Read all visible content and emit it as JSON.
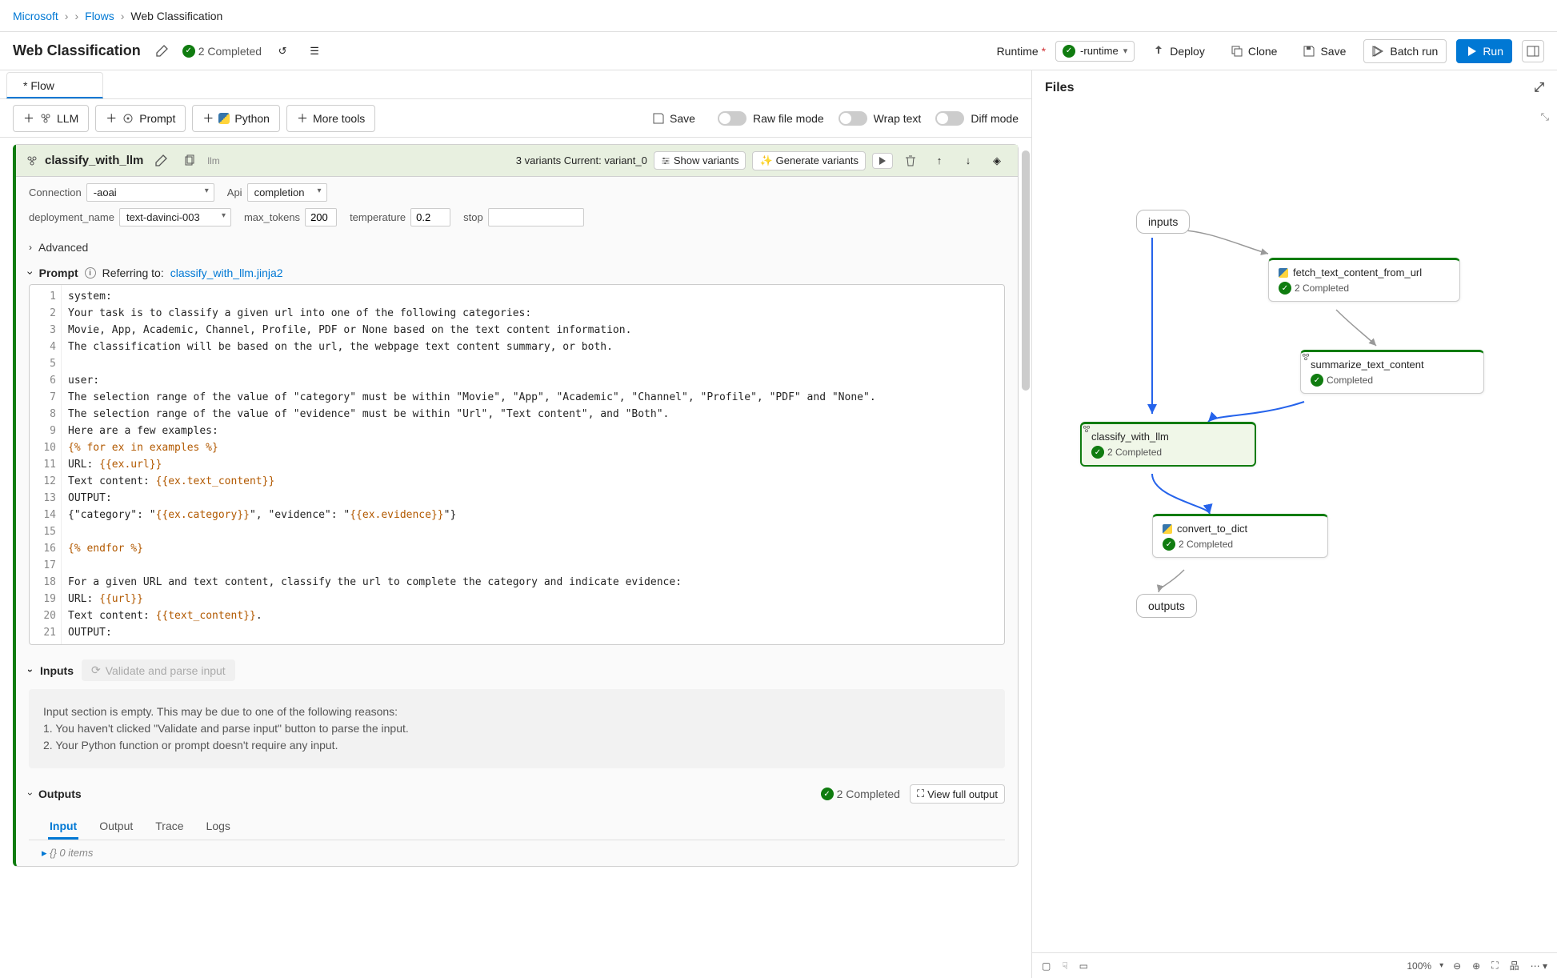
{
  "breadcrumb": {
    "root": "Microsoft",
    "flows": "Flows",
    "current": "Web Classification"
  },
  "header": {
    "title": "Web Classification",
    "status": "2 Completed",
    "runtime_label": "Runtime",
    "runtime_name": "-runtime",
    "deploy": "Deploy",
    "clone": "Clone",
    "save": "Save",
    "batch": "Batch run",
    "run": "Run"
  },
  "tab": {
    "flow": "* Flow"
  },
  "toolbar": {
    "llm": "LLM",
    "prompt": "Prompt",
    "python": "Python",
    "more": "More tools",
    "save": "Save",
    "raw": "Raw file mode",
    "wrap": "Wrap text",
    "diff": "Diff mode"
  },
  "node": {
    "name": "classify_with_llm",
    "type": "llm",
    "variants_text": "3 variants  Current: variant_0",
    "show_variants": "Show variants",
    "generate": "Generate variants",
    "connection_label": "Connection",
    "connection_value": "-aoai",
    "api_label": "Api",
    "api_value": "completion",
    "deployment_label": "deployment_name",
    "deployment_value": "text-davinci-003",
    "maxtok_label": "max_tokens",
    "maxtok_value": "200",
    "temp_label": "temperature",
    "temp_value": "0.2",
    "stop_label": "stop",
    "stop_value": "",
    "advanced": "Advanced",
    "prompt_label": "Prompt",
    "referring": "Referring to:",
    "referring_file": "classify_with_llm.jinja2"
  },
  "code_lines": [
    "system:",
    "Your task is to classify a given url into one of the following categories:",
    "Movie, App, Academic, Channel, Profile, PDF or None based on the text content information.",
    "The classification will be based on the url, the webpage text content summary, or both.",
    "",
    "user:",
    "The selection range of the value of \"category\" must be within \"Movie\", \"App\", \"Academic\", \"Channel\", \"Profile\", \"PDF\" and \"None\".",
    "The selection range of the value of \"evidence\" must be within \"Url\", \"Text content\", and \"Both\".",
    "Here are a few examples:",
    "{% for ex in examples %}",
    "URL: {{ex.url}}",
    "Text content: {{ex.text_content}}",
    "OUTPUT:",
    "{\"category\": \"{{ex.category}}\", \"evidence\": \"{{ex.evidence}}\"}",
    "",
    "{% endfor %}",
    "",
    "For a given URL and text content, classify the url to complete the category and indicate evidence:",
    "URL: {{url}}",
    "Text content: {{text_content}}.",
    "OUTPUT:"
  ],
  "inputs": {
    "label": "Inputs",
    "validate": "Validate and parse input",
    "empty_title": "Input section is empty. This may be due to one of the following reasons:",
    "reason1": "1. You haven't clicked \"Validate and parse input\" button to parse the input.",
    "reason2": "2. Your Python function or prompt doesn't require any input."
  },
  "outputs": {
    "label": "Outputs",
    "status": "2 Completed",
    "viewfull": "View full output",
    "tabs": {
      "input": "Input",
      "output": "Output",
      "trace": "Trace",
      "logs": "Logs"
    },
    "content": "{}  0 items"
  },
  "files": {
    "header": "Files"
  },
  "graph": {
    "inputs": "inputs",
    "outputs": "outputs",
    "nodes": {
      "fetch": {
        "name": "fetch_text_content_from_url",
        "status": "2 Completed",
        "kind": "python"
      },
      "summ": {
        "name": "summarize_text_content",
        "status": "Completed",
        "kind": "llm"
      },
      "classify": {
        "name": "classify_with_llm",
        "status": "2 Completed",
        "kind": "llm"
      },
      "convert": {
        "name": "convert_to_dict",
        "status": "2 Completed",
        "kind": "python"
      }
    }
  },
  "zoom": "100%"
}
